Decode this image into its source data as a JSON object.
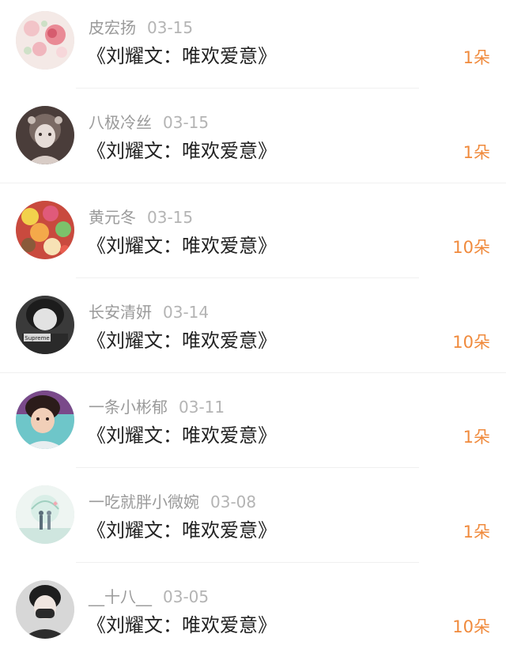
{
  "records": [
    {
      "user": "皮宏扬",
      "date": "03-15",
      "title": "《刘耀文：唯欢爱意》",
      "count": "1朵",
      "avatar": "flowers-avatar"
    },
    {
      "user": "八极冷丝",
      "date": "03-15",
      "title": "《刘耀文：唯欢爱意》",
      "count": "1朵",
      "avatar": "anime-girl-avatar"
    },
    {
      "user": "黄元冬",
      "date": "03-15",
      "title": "《刘耀文：唯欢爱意》",
      "count": "10朵",
      "avatar": "candy-avatar"
    },
    {
      "user": "长安清妍",
      "date": "03-14",
      "title": "《刘耀文：唯欢爱意》",
      "count": "10朵",
      "avatar": "supreme-girl-avatar",
      "avatar_text": "Supreme"
    },
    {
      "user": "一条小彬郁",
      "date": "03-11",
      "title": "《刘耀文：唯欢爱意》",
      "count": "1朵",
      "avatar": "boy-avatar"
    },
    {
      "user": "一吃就胖小微婉",
      "date": "03-08",
      "title": "《刘耀文：唯欢爱意》",
      "count": "1朵",
      "avatar": "couple-illustration-avatar"
    },
    {
      "user": "__十八__",
      "date": "03-05",
      "title": "《刘耀文：唯欢爱意》",
      "count": "10朵",
      "avatar": "masked-boy-avatar"
    }
  ],
  "colors": {
    "count": "#f08a3c",
    "username": "#9a9a9a",
    "title": "#222222"
  }
}
